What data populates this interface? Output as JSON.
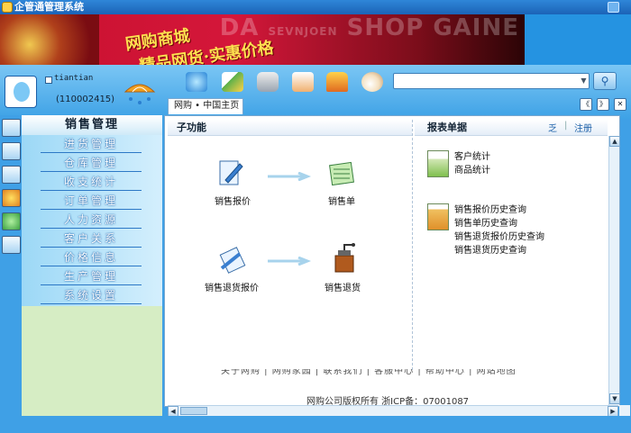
{
  "window": {
    "title": "企管通管理系统"
  },
  "banner": {
    "slogan_line1": "网购商城",
    "slogan_line2": "精品网货·实惠价格",
    "overlay_words": [
      "SHOP",
      "GAINE",
      "SEVNJOEN",
      "DA"
    ]
  },
  "user": {
    "name": "tiantian",
    "id": "(110002415)"
  },
  "toolbar": {
    "icons": [
      "globe-icon",
      "pen-icon",
      "camera-icon",
      "printer-icon",
      "shirt-icon",
      "teacup-icon"
    ],
    "search_value": "",
    "search_button_icon": "magnifier-icon"
  },
  "tabs": [
    {
      "label": "网购 • 中国主页"
    }
  ],
  "nav_buttons": {
    "prev": "《",
    "next": "》",
    "close": "✕"
  },
  "left_icons": [
    "edit-icon",
    "contacts-icon",
    "copy-icon",
    "radiation-icon",
    "email-icon",
    "folder-icon"
  ],
  "menu": {
    "header": "销售管理",
    "items": [
      "进货管理",
      "仓库管理",
      "收支统计",
      "订单管理",
      "人力资源",
      "客户关系",
      "价格信息",
      "生产管理",
      "系统设置"
    ]
  },
  "functions": {
    "header": "子功能",
    "items": [
      {
        "label": "销售报价",
        "icon": "quote-doc-icon"
      },
      {
        "label": "销售单",
        "icon": "sales-sheet-icon"
      },
      {
        "label": "销售退货报价",
        "icon": "return-quote-icon"
      },
      {
        "label": "销售退货",
        "icon": "grinder-icon"
      }
    ]
  },
  "reports": {
    "header": "报表单据",
    "register_partial": "乏",
    "register_label": "注册",
    "group1": [
      "客户统计",
      "商品统计"
    ],
    "group2": [
      "销售报价历史查询",
      "销售单历史查询",
      "销售退货报价历史查询",
      "销售退货历史查询"
    ]
  },
  "footer": {
    "links_cut": "关于网购 | 网购家园 | 联系我们 | 客服中心 | 帮助中心 | 网站地图",
    "copyright": "网购公司版权所有  浙ICP备：07001087"
  },
  "colors": {
    "chrome": "#3fa0e6",
    "banner": "#c8102e",
    "menu_text": "#ffffff",
    "menu_bg_lower": "#d6edc4"
  }
}
